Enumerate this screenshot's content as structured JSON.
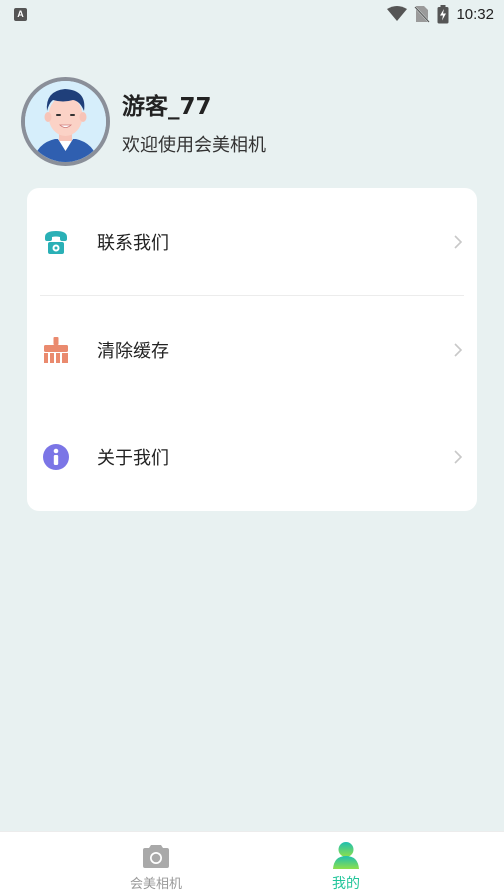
{
  "status_bar": {
    "indicator": "A",
    "time": "10:32",
    "icons": [
      "wifi-icon",
      "no-sim-icon",
      "battery-charging-icon"
    ]
  },
  "profile": {
    "username": "游客_77",
    "welcome": "欢迎使用会美相机"
  },
  "menu": {
    "items": [
      {
        "label": "联系我们",
        "icon": "phone-icon",
        "color": "#2ab0b6"
      },
      {
        "label": "清除缓存",
        "icon": "brush-icon",
        "color": "#ea8a6e"
      },
      {
        "label": "关于我们",
        "icon": "info-icon",
        "color": "#7b75e6"
      }
    ]
  },
  "tabbar": {
    "tabs": [
      {
        "label": "会美相机",
        "icon": "camera-icon",
        "active": false
      },
      {
        "label": "我的",
        "icon": "user-icon",
        "active": true
      }
    ],
    "active_color": "#22c59a",
    "inactive_color": "#999999"
  }
}
